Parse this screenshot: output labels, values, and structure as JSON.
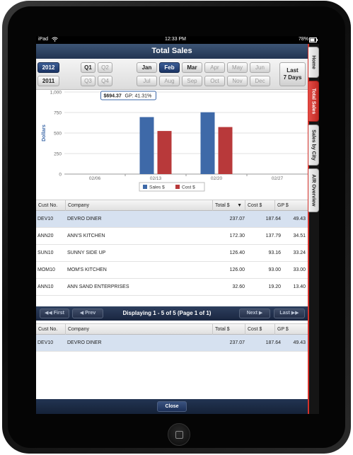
{
  "status": {
    "device": "iPad",
    "wifi_icon": "wifi-icon",
    "time": "12:33 PM",
    "battery": "78%"
  },
  "title": "Total Sales",
  "years": [
    "2012",
    "2011"
  ],
  "selected_year": "2012",
  "quarters": [
    "Q1",
    "Q2",
    "Q3",
    "Q4"
  ],
  "months": [
    "Jan",
    "Feb",
    "Mar",
    "Apr",
    "May",
    "Jun",
    "Jul",
    "Aug",
    "Sep",
    "Oct",
    "Nov",
    "Dec"
  ],
  "selected_month": "Feb",
  "last_days": {
    "line1": "Last",
    "line2": "7 Days"
  },
  "tooltip": {
    "value": "$694.37",
    "detail": "GP: 41.31%"
  },
  "chart_data": {
    "type": "bar",
    "categories": [
      "02/06",
      "02/13",
      "02/20",
      "02/27"
    ],
    "series": [
      {
        "name": "Sales $",
        "values": [
          0,
          694.37,
          753,
          0
        ],
        "color": "#3e69a8"
      },
      {
        "name": "Cost $",
        "values": [
          0,
          525,
          573,
          0
        ],
        "color": "#b8393a"
      }
    ],
    "ylabel": "Dollars",
    "ylim": [
      0,
      1000
    ],
    "yticks": [
      "0",
      "250",
      "500",
      "750",
      "1,000"
    ],
    "legend_position": "bottom"
  },
  "grid": {
    "headers": {
      "cust": "Cust No.",
      "company": "Company",
      "total": "Total $",
      "cost": "Cost $",
      "gp": "GP $"
    },
    "rows": [
      {
        "cust": "DEV10",
        "company": "DEVRO DINER",
        "total": "237.07",
        "cost": "187.64",
        "gp": "49.43"
      },
      {
        "cust": "ANN20",
        "company": "ANN'S KITCHEN",
        "total": "172.30",
        "cost": "137.79",
        "gp": "34.51"
      },
      {
        "cust": "SUN10",
        "company": "SUNNY SIDE UP",
        "total": "126.40",
        "cost": "93.16",
        "gp": "33.24"
      },
      {
        "cust": "MOM10",
        "company": "MOM'S KITCHEN",
        "total": "126.00",
        "cost": "93.00",
        "gp": "33.00"
      },
      {
        "cust": "ANN10",
        "company": "ANN SAND ENTERPRISES",
        "total": "32.60",
        "cost": "19.20",
        "gp": "13.40"
      }
    ]
  },
  "pager": {
    "first": "First",
    "prev": "Prev",
    "display": "Displaying 1 - 5 of 5 (Page 1 of 1)",
    "next": "Next",
    "last": "Last"
  },
  "detail": {
    "headers": {
      "cust": "Cust No.",
      "company": "Company",
      "total": "Total $",
      "cost": "Cost $",
      "gp": "GP $"
    },
    "rows": [
      {
        "cust": "DEV10",
        "company": "DEVRO DINER",
        "total": "237.07",
        "cost": "187.64",
        "gp": "49.43"
      }
    ]
  },
  "close_label": "Close",
  "side_tabs": [
    "Home",
    "Total Sales",
    "Sales by City",
    "A/R Overview"
  ],
  "active_side_tab": "Total Sales"
}
